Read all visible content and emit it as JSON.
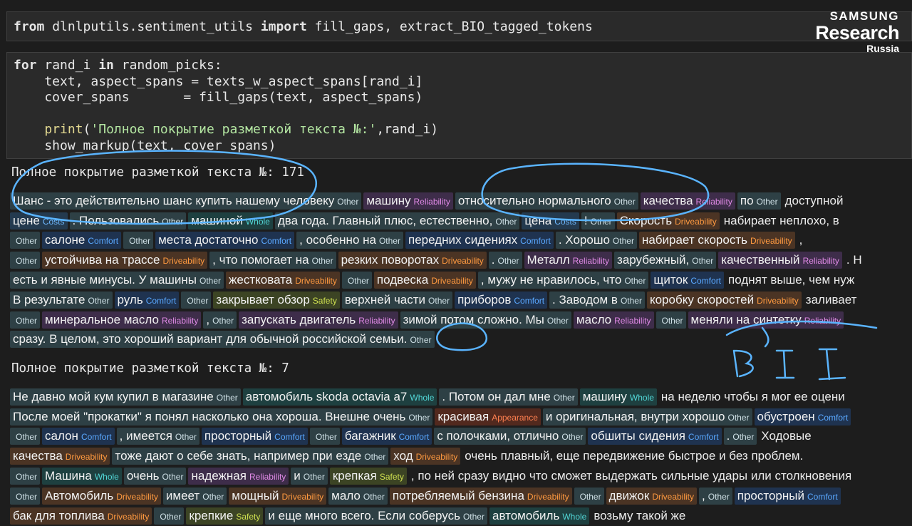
{
  "logo": {
    "line1": "SAMSUNG",
    "line2": "Research",
    "line3": "Russia"
  },
  "code_cells": [
    {
      "lines": [
        [
          [
            "from",
            "kw"
          ],
          [
            " dlnlputils.sentiment_utils ",
            ""
          ],
          [
            "import",
            "kw"
          ],
          [
            " fill_gaps, extract_BIO_tagged_tokens",
            ""
          ]
        ]
      ]
    },
    {
      "lines": [
        [
          [
            "for",
            "kw"
          ],
          [
            " rand_i ",
            ""
          ],
          [
            "in",
            "kw"
          ],
          [
            " random_picks:",
            ""
          ]
        ],
        [
          [
            "    text, aspect_spans = texts_w_aspect_spans[rand_i]",
            ""
          ]
        ],
        [
          [
            "    cover_spans       = fill_gaps(text, aspect_spans)",
            ""
          ]
        ],
        [
          [
            "",
            ""
          ]
        ],
        [
          [
            "    ",
            ""
          ],
          [
            "print",
            "fn"
          ],
          [
            "(",
            ""
          ],
          [
            "'Полное покрытие разметкой текста №:'",
            "str"
          ],
          [
            ",rand_i)",
            ""
          ]
        ],
        [
          [
            "    show_markup(text, cover_spans)",
            ""
          ]
        ]
      ]
    }
  ],
  "outputs": [
    {
      "header": "Полное покрытие разметкой текста №: 171",
      "lines": [
        [
          [
            "Шанс - это действительно шанс купить нашему человеку",
            "Other"
          ],
          [
            "машину",
            "Reliability"
          ],
          [
            "относительно нормального",
            "Other"
          ],
          [
            "качества",
            "Reliability"
          ],
          [
            "по",
            "Other"
          ],
          [
            "доступной",
            ""
          ]
        ],
        [
          [
            "цене",
            "Costs"
          ],
          [
            ". Пользовались",
            "Other"
          ],
          [
            "машиной",
            "Whole"
          ],
          [
            "два года. Главный плюс, естественно,",
            "Other"
          ],
          [
            "цена",
            "Costs"
          ],
          [
            "!",
            "Other"
          ],
          [
            "Скорость",
            "Driveability"
          ],
          [
            "набирает неплохо, в",
            ""
          ]
        ],
        [
          [
            "",
            "Other"
          ],
          [
            "салоне",
            "Comfort"
          ],
          [
            "",
            "Other"
          ],
          [
            "места достаточно",
            "Comfort"
          ],
          [
            ", особенно на",
            "Other"
          ],
          [
            "передних сидениях",
            "Comfort"
          ],
          [
            ". Хорошо",
            "Other"
          ],
          [
            "набирает скорость",
            "Driveability"
          ],
          [
            ",",
            ""
          ]
        ],
        [
          [
            "",
            "Other"
          ],
          [
            "устойчива на трассе",
            "Driveability"
          ],
          [
            ", что помогает на",
            "Other"
          ],
          [
            "резких поворотах",
            "Driveability"
          ],
          [
            ".",
            "Other"
          ],
          [
            "Металл",
            "Reliability"
          ],
          [
            "зарубежный,",
            "Other"
          ],
          [
            "качественный",
            "Reliability"
          ],
          [
            ". Н",
            ""
          ]
        ],
        [
          [
            "есть и явные минусы. У машины",
            "Other"
          ],
          [
            "жестковата",
            "Driveability"
          ],
          [
            "",
            "Other"
          ],
          [
            "подвеска",
            "Driveability"
          ],
          [
            ", мужу не нравилось, что",
            "Other"
          ],
          [
            "щиток",
            "Comfort"
          ],
          [
            "поднят выше, чем нуж",
            ""
          ]
        ],
        [
          [
            "В результате",
            "Other"
          ],
          [
            "руль",
            "Comfort"
          ],
          [
            "",
            "Other"
          ],
          [
            "закрывает обзор",
            "Safety"
          ],
          [
            "верхней части",
            "Other"
          ],
          [
            "приборов",
            "Comfort"
          ],
          [
            ". Заводом в",
            "Other"
          ],
          [
            "коробку скоростей",
            "Driveability"
          ],
          [
            "заливает",
            ""
          ]
        ],
        [
          [
            "",
            "Other"
          ],
          [
            "минеральное масло",
            "Reliability"
          ],
          [
            ",",
            "Other"
          ],
          [
            "запускать двигатель",
            "Reliability"
          ],
          [
            "зимой потом сложно. Мы",
            "Other"
          ],
          [
            "масло",
            "Reliability"
          ],
          [
            "",
            "Other"
          ],
          [
            "меняли на синтетку",
            "Reliability"
          ]
        ],
        [
          [
            "сразу. В целом, это хороший вариант для обычной российской семьи.",
            "Other"
          ]
        ]
      ]
    },
    {
      "header": "Полное покрытие разметкой текста №: 7",
      "lines": [
        [
          [
            "Не давно мой кум купил в магазине",
            "Other"
          ],
          [
            "автомобиль skoda octavia a7",
            "Whole"
          ],
          [
            ". Потом он дал мне",
            "Other"
          ],
          [
            "машину",
            "Whole"
          ],
          [
            "на неделю чтобы я мог ее оцени",
            ""
          ]
        ],
        [
          [
            "После моей \"прокатки\" я понял насколько она хороша. Внешне очень",
            "Other"
          ],
          [
            "красивая",
            "Appearance"
          ],
          [
            "и оригинальная, внутри хорошо",
            "Other"
          ],
          [
            "обустроен",
            "Comfort"
          ]
        ],
        [
          [
            "",
            "Other"
          ],
          [
            "салон",
            "Comfort"
          ],
          [
            ", имеется",
            "Other"
          ],
          [
            "просторный",
            "Comfort"
          ],
          [
            "",
            "Other"
          ],
          [
            "багажник",
            "Comfort"
          ],
          [
            "с полочками, отлично",
            "Other"
          ],
          [
            "обшиты сидения",
            "Comfort"
          ],
          [
            ".",
            "Other"
          ],
          [
            "Ходовые",
            ""
          ]
        ],
        [
          [
            "качества",
            "Driveability"
          ],
          [
            "тоже дают о себе знать, например при езде",
            "Other"
          ],
          [
            "ход",
            "Driveability"
          ],
          [
            "очень плавный, еще передвижение быстрое и без проблем.",
            ""
          ]
        ],
        [
          [
            "",
            "Other"
          ],
          [
            "Машина",
            "Whole"
          ],
          [
            "очень",
            "Other"
          ],
          [
            "надежная",
            "Reliability"
          ],
          [
            "и",
            "Other"
          ],
          [
            "крепкая",
            "Safety"
          ],
          [
            ", по ней сразу видно что сможет выдержать сильные удары или столкновения",
            ""
          ]
        ],
        [
          [
            "",
            "Other"
          ],
          [
            "Автомобиль",
            "Driveability"
          ],
          [
            "имеет",
            "Other"
          ],
          [
            "мощный",
            "Driveability"
          ],
          [
            "мало",
            "Other"
          ],
          [
            "потребляемый бензина",
            "Driveability"
          ],
          [
            "",
            "Other"
          ],
          [
            "движок",
            "Driveability"
          ],
          [
            ",",
            "Other"
          ],
          [
            "просторный",
            "Comfort"
          ]
        ],
        [
          [
            "бак для топлива",
            "Driveability"
          ],
          [
            "",
            "Other"
          ],
          [
            "крепкие",
            "Safety"
          ],
          [
            "и еще много всего. Если соберусь",
            "Other"
          ],
          [
            "автомобиль",
            "Whole"
          ],
          [
            "возьму такой же",
            ""
          ]
        ]
      ]
    }
  ],
  "annotation": {
    "handwriting": "B I I"
  }
}
